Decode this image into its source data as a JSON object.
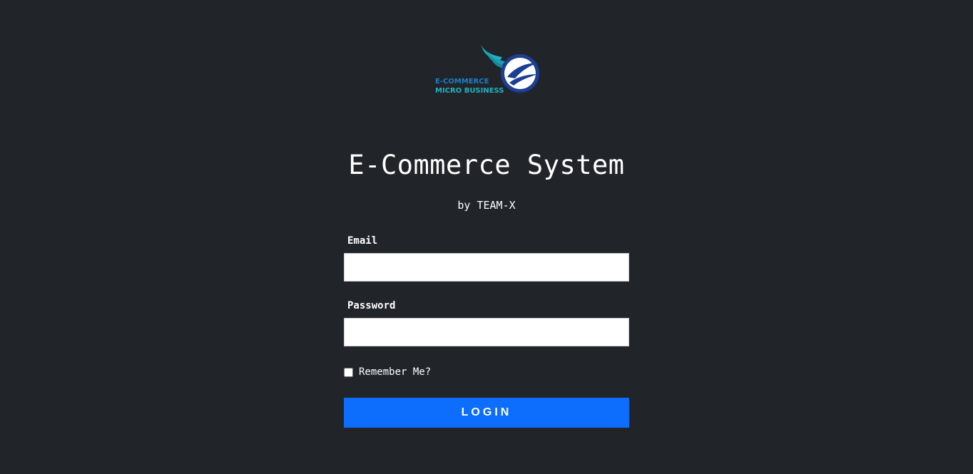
{
  "logo": {
    "text_top": "E-COMMERCE",
    "text_bottom": "MICRO BUSINESS",
    "colors": {
      "teal": "#1fb3c3",
      "navy": "#1c3f94",
      "white": "#ffffff"
    }
  },
  "header": {
    "title": "E-Commerce System",
    "subtitle": "by TEAM-X"
  },
  "form": {
    "email_label": "Email",
    "email_value": "",
    "password_label": "Password",
    "password_value": "",
    "remember_label": "Remember Me?",
    "remember_checked": false,
    "login_label": "LOGIN"
  },
  "colors": {
    "background": "#212429",
    "primary": "#0d6efd",
    "text": "#ffffff"
  }
}
